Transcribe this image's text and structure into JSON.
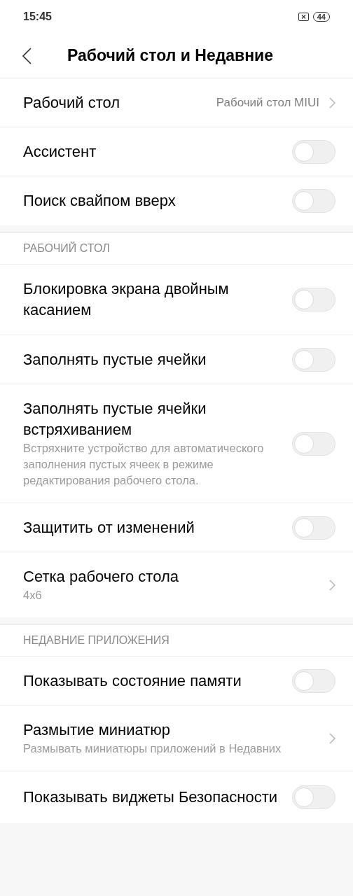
{
  "status_bar": {
    "time": "15:45",
    "battery": "44"
  },
  "header": {
    "title": "Рабочий стол и Недавние"
  },
  "groups": [
    {
      "items": [
        {
          "kind": "link",
          "title": "Рабочий стол",
          "value": "Рабочий стол MIUI"
        },
        {
          "kind": "toggle",
          "title": "Ассистент",
          "on": false
        },
        {
          "kind": "toggle",
          "title": "Поиск свайпом вверх",
          "on": false
        }
      ]
    },
    {
      "header": "РАБОЧИЙ СТОЛ",
      "items": [
        {
          "kind": "toggle",
          "title": "Блокировка экрана двойным касанием",
          "on": false
        },
        {
          "kind": "toggle",
          "title": "Заполнять пустые ячейки",
          "on": false
        },
        {
          "kind": "toggle",
          "title": "Заполнять пустые ячейки встряхиванием",
          "subtitle": "Встряхните устройство для автоматического заполнения пустых ячеек в режиме редактирования рабочего стола.",
          "on": false
        },
        {
          "kind": "toggle",
          "title": "Защитить от изменений",
          "on": false
        },
        {
          "kind": "link",
          "title": "Сетка рабочего стола",
          "subtitle": "4x6"
        }
      ]
    },
    {
      "header": "НЕДАВНИЕ ПРИЛОЖЕНИЯ",
      "items": [
        {
          "kind": "toggle",
          "title": "Показывать состояние памяти",
          "on": false
        },
        {
          "kind": "link",
          "title": "Размытие миниатюр",
          "subtitle": "Размывать миниатюры приложений в Недавних"
        },
        {
          "kind": "toggle",
          "title": "Показывать виджеты Безопасности",
          "on": false
        }
      ]
    }
  ]
}
